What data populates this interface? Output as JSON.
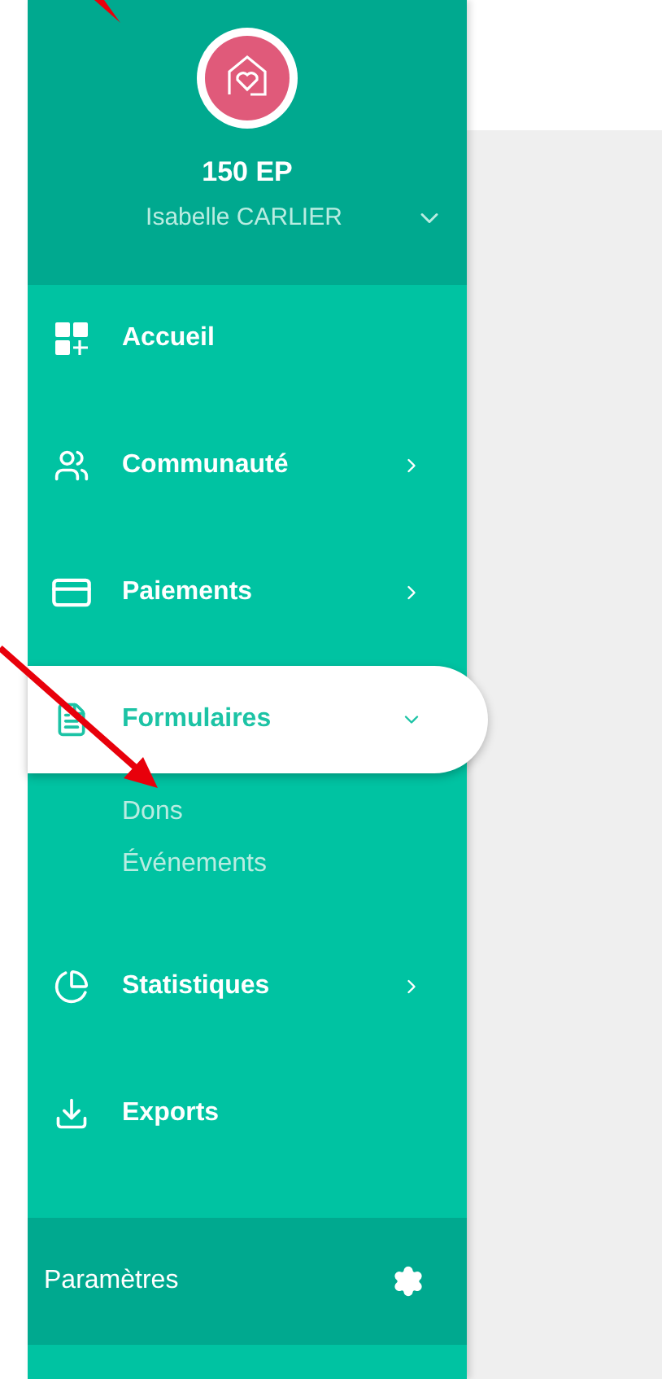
{
  "profile": {
    "title": "150 EP",
    "user": "Isabelle CARLIER"
  },
  "menu": [
    {
      "label": "Accueil",
      "selected": false
    },
    {
      "label": "Communauté",
      "expanded": false,
      "selected": false
    },
    {
      "label": "Paiements",
      "expanded": false,
      "selected": false
    },
    {
      "label": "Formulaires",
      "expanded": true,
      "selected": true,
      "children": [
        {
          "label": "Dons"
        },
        {
          "label": "Événements"
        }
      ]
    },
    {
      "label": "Statistiques",
      "expanded": false,
      "selected": false
    },
    {
      "label": "Exports",
      "selected": false
    }
  ],
  "footer": {
    "label": "Paramètres"
  }
}
